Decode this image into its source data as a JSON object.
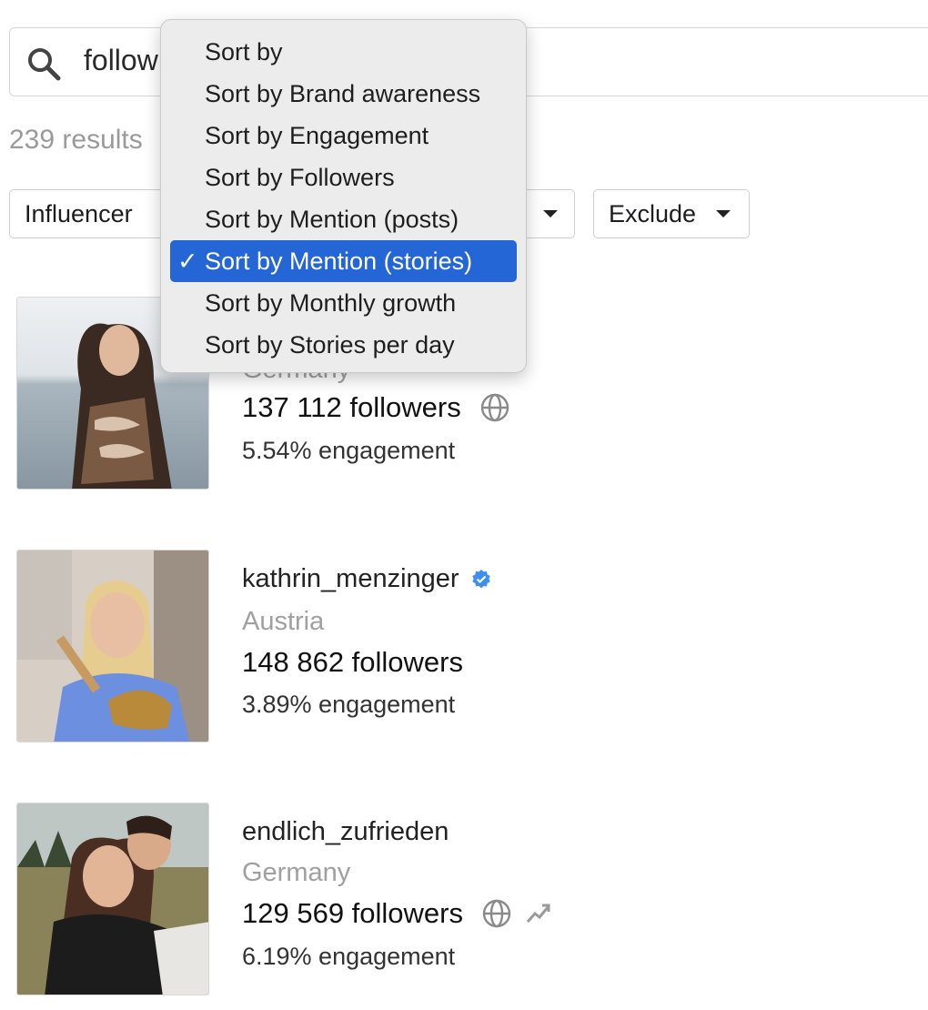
{
  "search": {
    "value": "follow"
  },
  "results": {
    "count_text": "239 results"
  },
  "filters": [
    {
      "label": "Influencer"
    },
    {
      "label": ""
    },
    {
      "label": "Exclude"
    }
  ],
  "sort_menu": {
    "items": [
      {
        "label": "Sort by",
        "selected": false
      },
      {
        "label": "Sort by Brand awareness",
        "selected": false
      },
      {
        "label": "Sort by Engagement",
        "selected": false
      },
      {
        "label": "Sort by Followers",
        "selected": false
      },
      {
        "label": "Sort by Mention (posts)",
        "selected": false
      },
      {
        "label": "Sort by Mention (stories)",
        "selected": true
      },
      {
        "label": "Sort by Monthly growth",
        "selected": false
      },
      {
        "label": "Sort by Stories per day",
        "selected": false
      }
    ],
    "check_mark": "✓"
  },
  "influencers": [
    {
      "name": "",
      "country": "Germany",
      "followers": "137 112 followers",
      "engagement": "5.54% engagement",
      "icons": [
        "globe-icon"
      ]
    },
    {
      "name": "kathrin_menzinger",
      "country": "Austria",
      "followers": "148 862 followers",
      "engagement": "3.89% engagement",
      "icons": [
        "verified-badge-icon"
      ]
    },
    {
      "name": "endlich_zufrieden",
      "country": "Germany",
      "followers": "129 569 followers",
      "engagement": "6.19% engagement",
      "icons": [
        "globe-icon",
        "trend-up-icon"
      ]
    }
  ],
  "colors": {
    "selection_blue": "#2466d6",
    "verified_blue": "#3d8ef0",
    "muted_text": "#a0a0a0"
  }
}
